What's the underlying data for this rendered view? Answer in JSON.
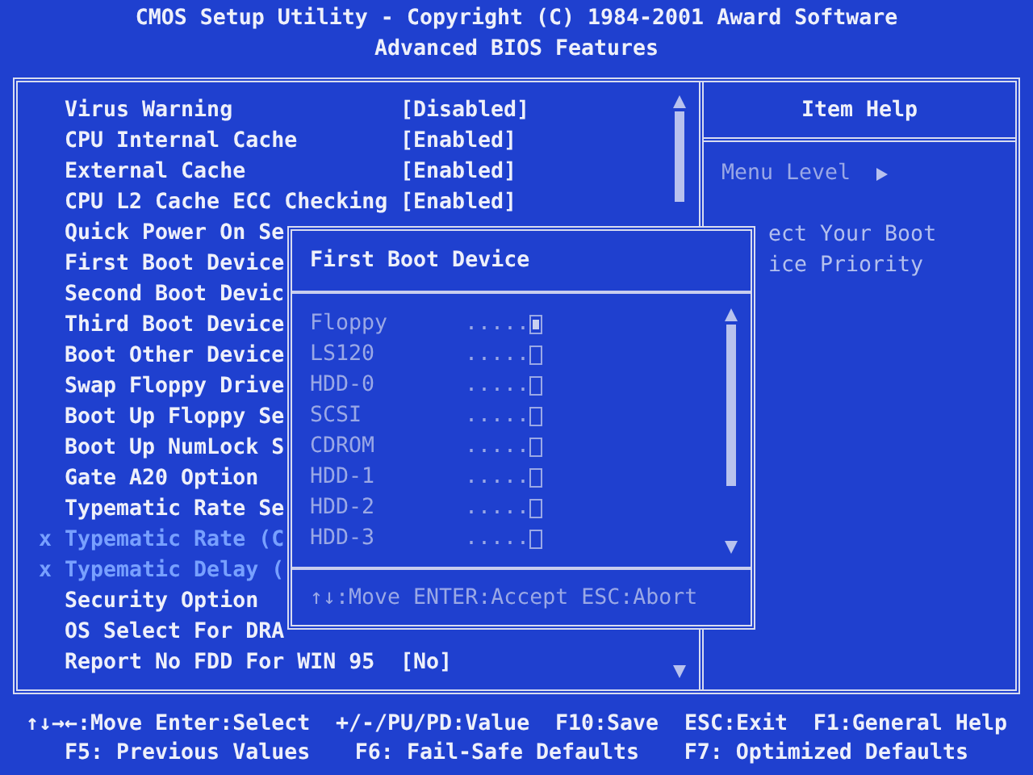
{
  "header": {
    "title": "CMOS Setup Utility - Copyright (C) 1984-2001 Award Software",
    "subtitle": "Advanced BIOS Features"
  },
  "menu_items": [
    {
      "label": "Virus Warning",
      "value": "[Disabled]",
      "disabled": false
    },
    {
      "label": "CPU Internal Cache",
      "value": "[Enabled]",
      "disabled": false
    },
    {
      "label": "External Cache",
      "value": "[Enabled]",
      "disabled": false
    },
    {
      "label": "CPU L2 Cache ECC Checking",
      "value": "[Enabled]",
      "disabled": false
    },
    {
      "label": "Quick Power On Se",
      "disabled": false
    },
    {
      "label": "First Boot Device",
      "disabled": false
    },
    {
      "label": "Second Boot Devic",
      "disabled": false
    },
    {
      "label": "Third Boot Device",
      "disabled": false
    },
    {
      "label": "Boot Other Device",
      "disabled": false
    },
    {
      "label": "Swap Floppy Drive",
      "disabled": false
    },
    {
      "label": "Boot Up Floppy Se",
      "disabled": false
    },
    {
      "label": "Boot Up NumLock S",
      "disabled": false
    },
    {
      "label": "Gate A20 Option",
      "disabled": false
    },
    {
      "label": "Typematic Rate Se",
      "disabled": false
    },
    {
      "label": "Typematic Rate (C",
      "marker": "x",
      "disabled": true
    },
    {
      "label": "Typematic Delay (",
      "marker": "x",
      "disabled": true
    },
    {
      "label": "Security Option",
      "disabled": false
    },
    {
      "label": "OS Select For DRA",
      "disabled": false
    },
    {
      "label": "Report No FDD For WIN 95",
      "value": "[No]",
      "disabled": false
    }
  ],
  "help": {
    "title": "Item Help",
    "menu_level": "Menu Level",
    "lines": [
      "ect Your Boot",
      "ice Priority"
    ]
  },
  "popup": {
    "title": "First Boot Device",
    "options": [
      {
        "name": "Floppy",
        "dots": ".....",
        "selected": true
      },
      {
        "name": "LS120",
        "dots": ".....",
        "selected": false
      },
      {
        "name": "HDD-0",
        "dots": ".....",
        "selected": false
      },
      {
        "name": "SCSI",
        "dots": ".....",
        "selected": false
      },
      {
        "name": "CDROM",
        "dots": ".....",
        "selected": false
      },
      {
        "name": "HDD-1",
        "dots": ".....",
        "selected": false
      },
      {
        "name": "HDD-2",
        "dots": ".....",
        "selected": false
      },
      {
        "name": "HDD-3",
        "dots": ".....",
        "selected": false
      }
    ],
    "footer": "↑↓:Move ENTER:Accept ESC:Abort"
  },
  "key_help": [
    [
      "↑↓→←:Move Enter:Select",
      "+/-/PU/PD:Value",
      "F10:Save",
      "ESC:Exit",
      "F1:General Help"
    ],
    [
      "F5: Previous Values",
      "F6: Fail-Safe Defaults",
      "F7: Optimized Defaults"
    ]
  ]
}
